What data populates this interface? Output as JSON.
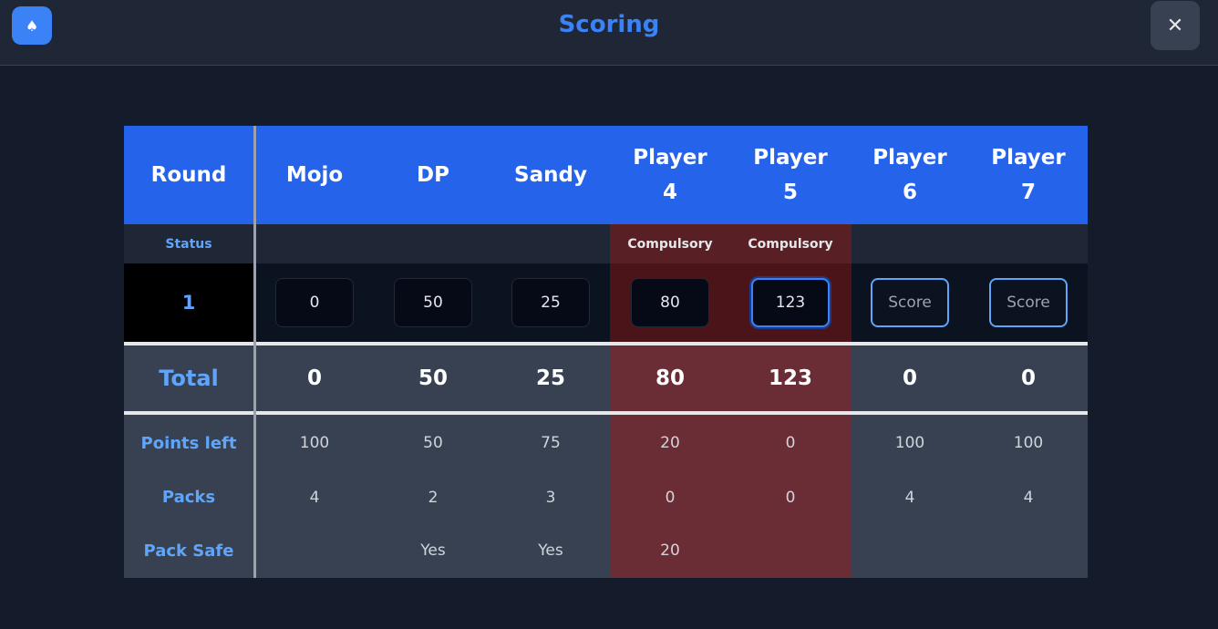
{
  "header": {
    "app_icon": "spade-icon",
    "title": "Scoring",
    "close_icon": "close-icon",
    "close_glyph": "✕"
  },
  "table": {
    "round_header": "Round",
    "players": [
      {
        "name_line1": "Mojo",
        "name_line2": "",
        "status": "",
        "score_value": "0",
        "score_placeholder": "Score",
        "total": "0",
        "points_left": "100",
        "packs": "4",
        "pack_safe": ""
      },
      {
        "name_line1": "DP",
        "name_line2": "",
        "status": "",
        "score_value": "50",
        "score_placeholder": "Score",
        "total": "50",
        "points_left": "50",
        "packs": "2",
        "pack_safe": "Yes"
      },
      {
        "name_line1": "Sandy",
        "name_line2": "",
        "status": "",
        "score_value": "25",
        "score_placeholder": "Score",
        "total": "25",
        "points_left": "75",
        "packs": "3",
        "pack_safe": "Yes"
      },
      {
        "name_line1": "Player",
        "name_line2": "4",
        "status": "Compulsory",
        "score_value": "80",
        "score_placeholder": "Score",
        "total": "80",
        "points_left": "20",
        "packs": "0",
        "pack_safe": "20"
      },
      {
        "name_line1": "Player",
        "name_line2": "5",
        "status": "Compulsory",
        "score_value": "123",
        "score_placeholder": "Score",
        "total": "123",
        "points_left": "0",
        "packs": "0",
        "pack_safe": ""
      },
      {
        "name_line1": "Player",
        "name_line2": "6",
        "status": "",
        "score_value": "",
        "score_placeholder": "Score",
        "total": "0",
        "points_left": "100",
        "packs": "4",
        "pack_safe": ""
      },
      {
        "name_line1": "Player",
        "name_line2": "7",
        "status": "",
        "score_value": "",
        "score_placeholder": "Score",
        "total": "0",
        "points_left": "100",
        "packs": "4",
        "pack_safe": ""
      }
    ],
    "status_label": "Status",
    "round_number": "1",
    "total_label": "Total",
    "points_left_label": "Points left",
    "packs_label": "Packs",
    "pack_safe_label": "Pack Safe"
  },
  "colors": {
    "accent": "#3b82f6",
    "header_bg": "#2563eb",
    "highlight_column": "#6b2d35"
  }
}
